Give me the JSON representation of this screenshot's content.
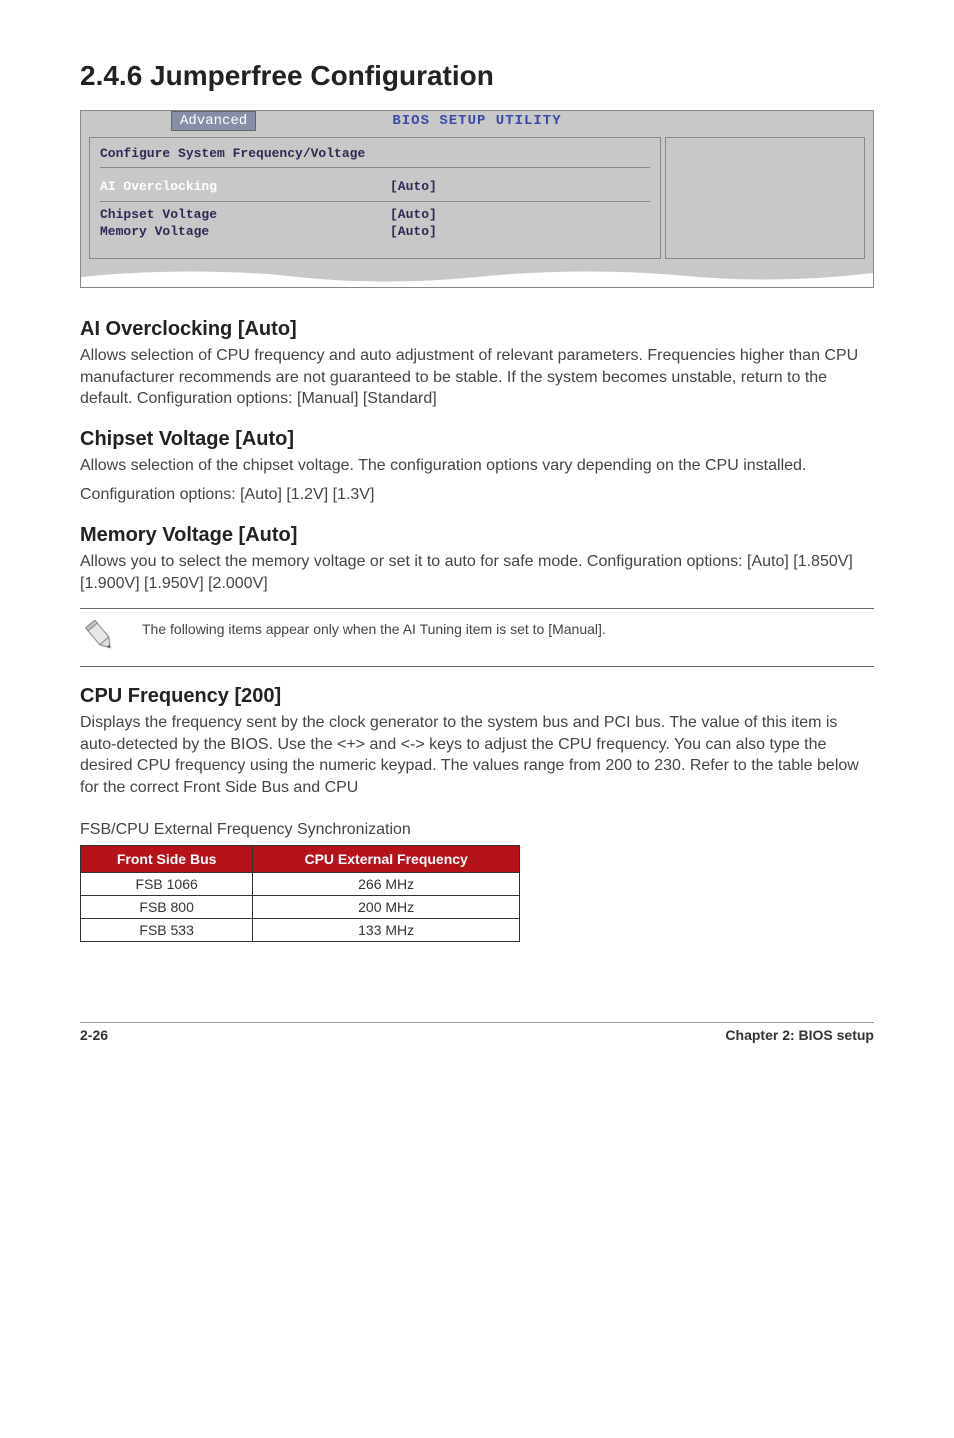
{
  "section": {
    "number_title": "2.4.6   Jumperfree Configuration"
  },
  "bios": {
    "title": "BIOS SETUP UTILITY",
    "tab": "Advanced",
    "heading": "Configure System Frequency/Voltage",
    "rows": [
      {
        "label": "AI Overclocking",
        "value": "[Auto]",
        "selected": true
      },
      {
        "label": "Chipset Voltage",
        "value": "[Auto]",
        "selected": false
      },
      {
        "label": "Memory Voltage",
        "value": "[Auto]",
        "selected": false
      }
    ]
  },
  "ai_overclocking": {
    "heading": "AI Overclocking [Auto]",
    "text": "Allows selection of CPU frequency and auto adjustment of relevant parameters. Frequencies higher than CPU manufacturer recommends are not guaranteed to be stable. If the system becomes unstable, return to the default. Configuration options: [Manual] [Standard]"
  },
  "chipset_voltage": {
    "heading": "Chipset Voltage [Auto]",
    "text1": "Allows selection of the chipset voltage. The configuration options vary depending on the CPU installed.",
    "text2": "Configuration options: [Auto] [1.2V] [1.3V]"
  },
  "memory_voltage": {
    "heading": "Memory Voltage [Auto]",
    "text": "Allows you to select the memory voltage or set it to auto for safe mode. Configuration options: [Auto] [1.850V] [1.900V] [1.950V] [2.000V]"
  },
  "note": {
    "text": "The following items appear only when the AI Tuning item is set to [Manual]."
  },
  "cpu_frequency": {
    "heading": "CPU Frequency [200]",
    "text": "Displays the frequency sent by the clock generator to the system bus and PCI bus. The value of this item is auto-detected by the BIOS. Use the <+> and <-> keys to adjust the CPU frequency. You can also type the desired CPU frequency using the numeric keypad. The values range from 200 to 230. Refer to the table below for the correct Front Side Bus and CPU"
  },
  "table": {
    "caption": "FSB/CPU External Frequency Synchronization",
    "headers": [
      "Front Side Bus",
      "CPU External Frequency"
    ],
    "rows": [
      [
        "FSB 1066",
        "266 MHz"
      ],
      [
        "FSB 800",
        "200 MHz"
      ],
      [
        "FSB 533",
        "133 MHz"
      ]
    ]
  },
  "footer": {
    "left": "2-26",
    "right": "Chapter 2: BIOS setup"
  }
}
